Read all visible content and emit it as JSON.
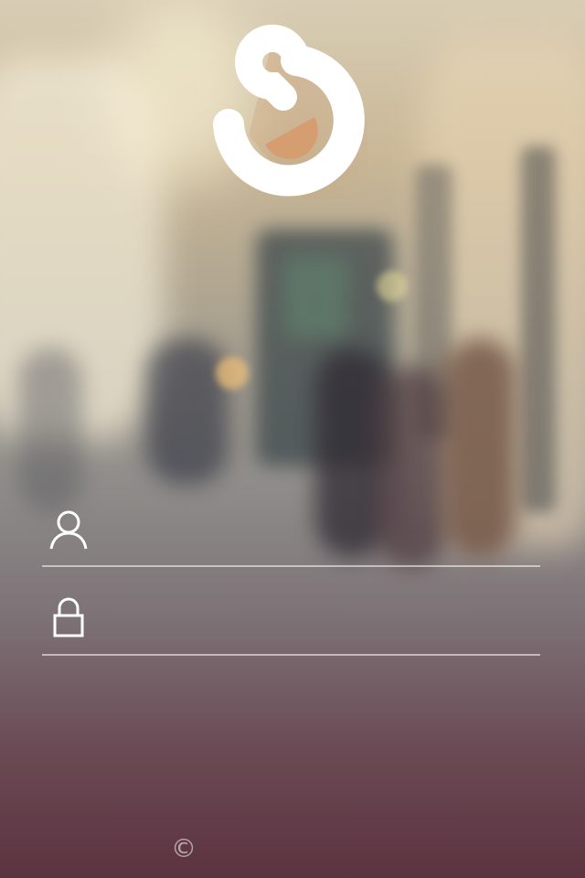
{
  "logo": {
    "icon": "s-swirl-logo",
    "color": "#ffffff"
  },
  "login": {
    "username": {
      "icon": "user-icon",
      "value": "",
      "placeholder": ""
    },
    "password": {
      "icon": "lock-icon",
      "value": "",
      "placeholder": ""
    }
  },
  "footer": {
    "copyright_symbol": "©"
  },
  "colors": {
    "background_top": "#d8cdb4",
    "background_bottom": "#5c3340",
    "field_line": "#ffffff"
  }
}
